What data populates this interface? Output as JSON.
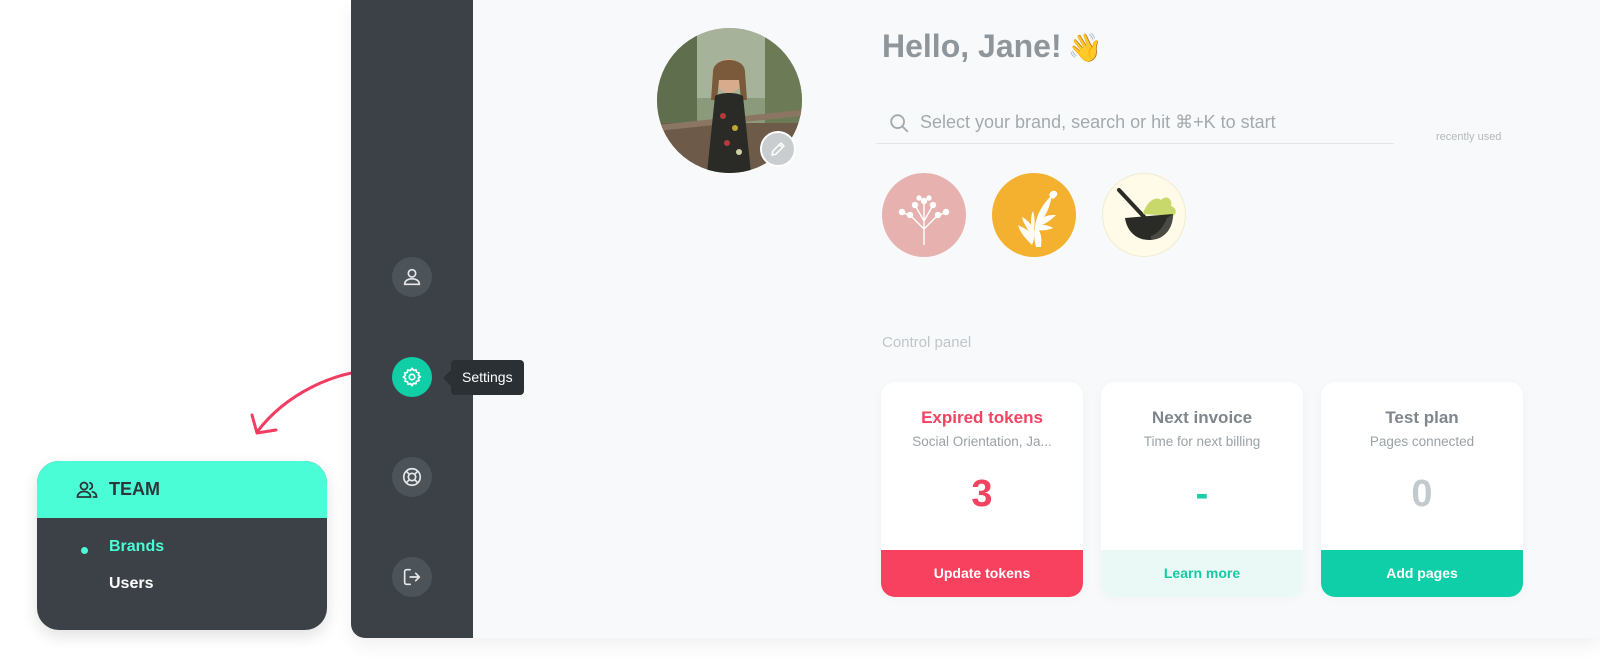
{
  "greeting": {
    "text": "Hello, Jane!",
    "emoji": "👋"
  },
  "search": {
    "placeholder": "Select your brand, search or hit ⌘+K to start"
  },
  "recently_used_label": "recently used",
  "brands": [
    {
      "name": "dandelion-brand",
      "color": "#e7b1b0"
    },
    {
      "name": "latte-art-brand",
      "color": "#f3b12f"
    },
    {
      "name": "matcha-bowl-brand",
      "color": "#fffbe8"
    }
  ],
  "sidebar": {
    "items": [
      {
        "name": "profile",
        "icon": "user-icon"
      },
      {
        "name": "settings",
        "icon": "gear-icon",
        "active": true
      },
      {
        "name": "support",
        "icon": "lifebuoy-icon"
      },
      {
        "name": "logout",
        "icon": "logout-icon"
      }
    ],
    "tooltip": "Settings"
  },
  "control_panel": {
    "label": "Control panel",
    "cards": [
      {
        "title": "Expired tokens",
        "subtitle": "Social Orientation, Ja...",
        "value": "3",
        "button": "Update tokens"
      },
      {
        "title": "Next invoice",
        "subtitle": "Time for next billing",
        "value": "-",
        "button": "Learn more"
      },
      {
        "title": "Test plan",
        "subtitle": "Pages connected",
        "value": "0",
        "button": "Add pages"
      }
    ]
  },
  "team_menu": {
    "title": "TEAM",
    "items": [
      {
        "label": "Brands",
        "active": true
      },
      {
        "label": "Users",
        "active": false
      }
    ]
  },
  "colors": {
    "accent": "#10cfa6",
    "danger": "#f8405f",
    "sidebar": "#3b4146",
    "team_header": "#4bfdd6",
    "annotation_arrow": "#f23c62"
  }
}
